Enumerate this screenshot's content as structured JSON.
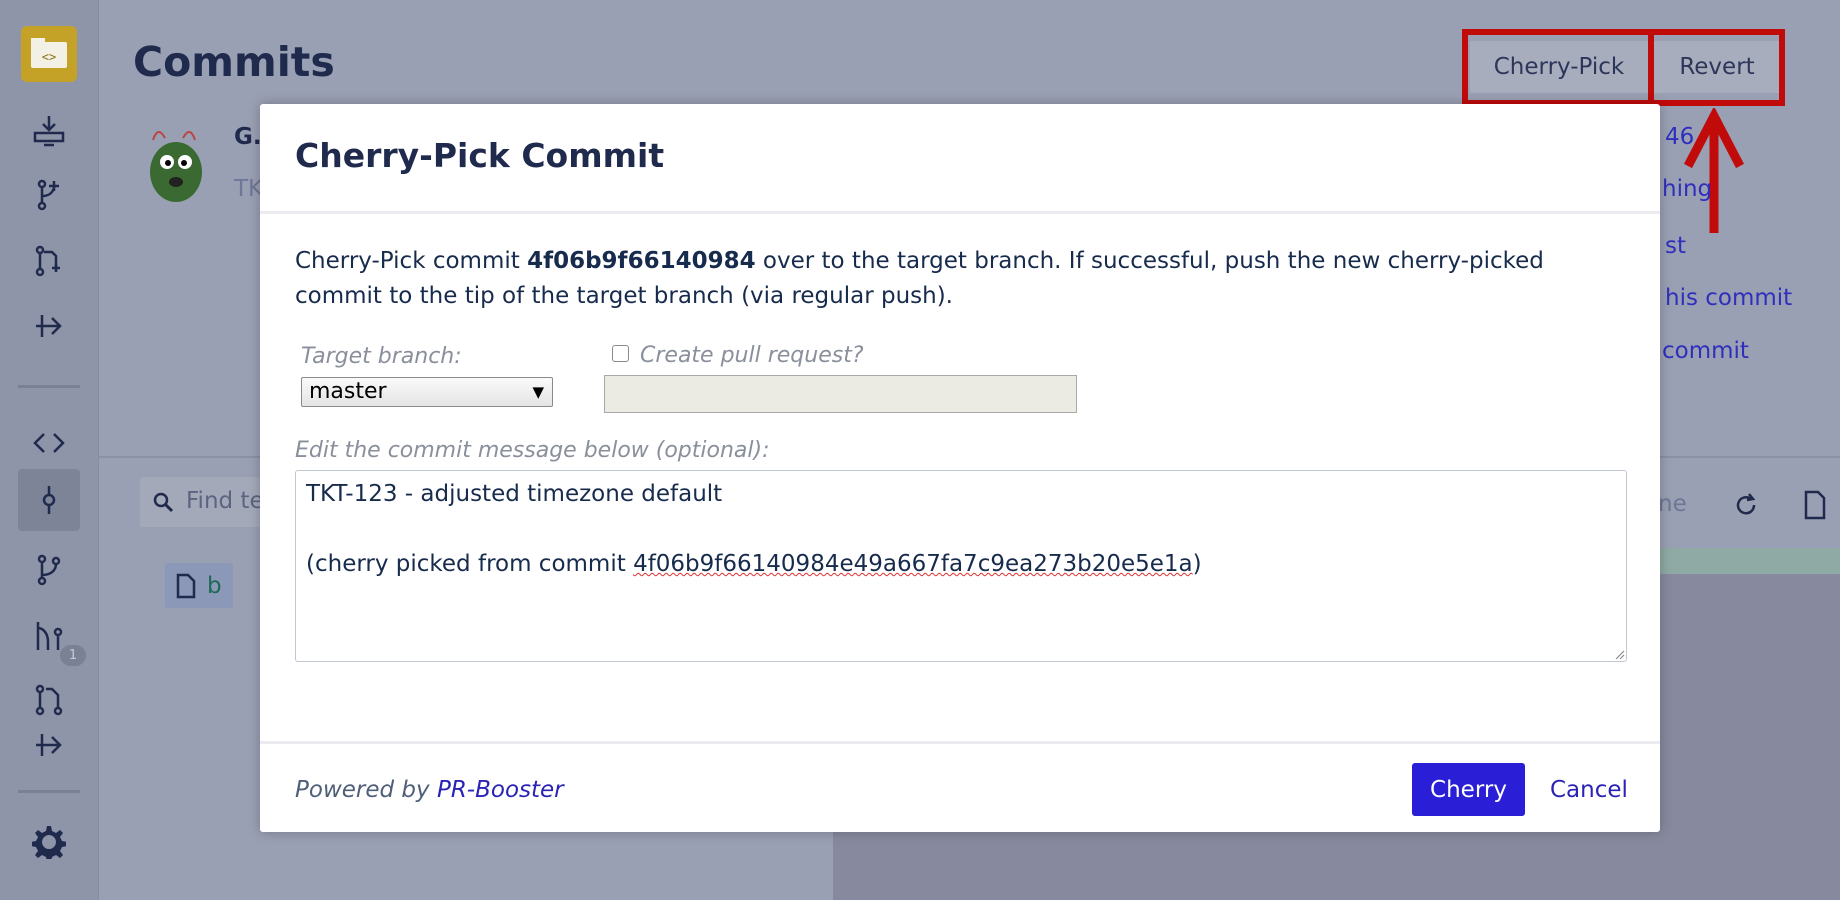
{
  "page": {
    "title": "Commits",
    "cherry_pick_label": "Cherry-Pick",
    "revert_label": "Revert",
    "author_initial": "G.",
    "commit_prefix": "TK",
    "right_fragments": [
      "46",
      "hing",
      "st",
      "his commit",
      "commit"
    ],
    "search_placeholder": "Find te",
    "right_label_fragment": "ne",
    "file_label": "b",
    "sidebar_badge": "1"
  },
  "modal": {
    "title": "Cherry-Pick Commit",
    "description_before": "Cherry-Pick commit ",
    "commit_hash": "4f06b9f66140984",
    "description_after": " over to the target branch. If successful, push the new cherry-picked commit to the tip of the target branch (via regular push).",
    "target_branch_label": "Target branch:",
    "target_branch_value": "master",
    "create_pr_label": "Create pull request?",
    "message_label": "Edit the commit message below (optional):",
    "message_line1": "TKT-123 - adjusted timezone default",
    "message_line3_prefix": "(cherry picked from commit ",
    "message_full_hash": "4f06b9f66140984e49a667fa7c9ea273b20e5e1a",
    "message_line3_suffix": ")",
    "powered_by": "Powered by ",
    "powered_link": "PR-Booster",
    "cherry_button": "Cherry",
    "cancel_button": "Cancel"
  },
  "colors": {
    "primary": "#2a1ed6",
    "annotation": "#c10a0a",
    "link": "#2b23b5"
  }
}
